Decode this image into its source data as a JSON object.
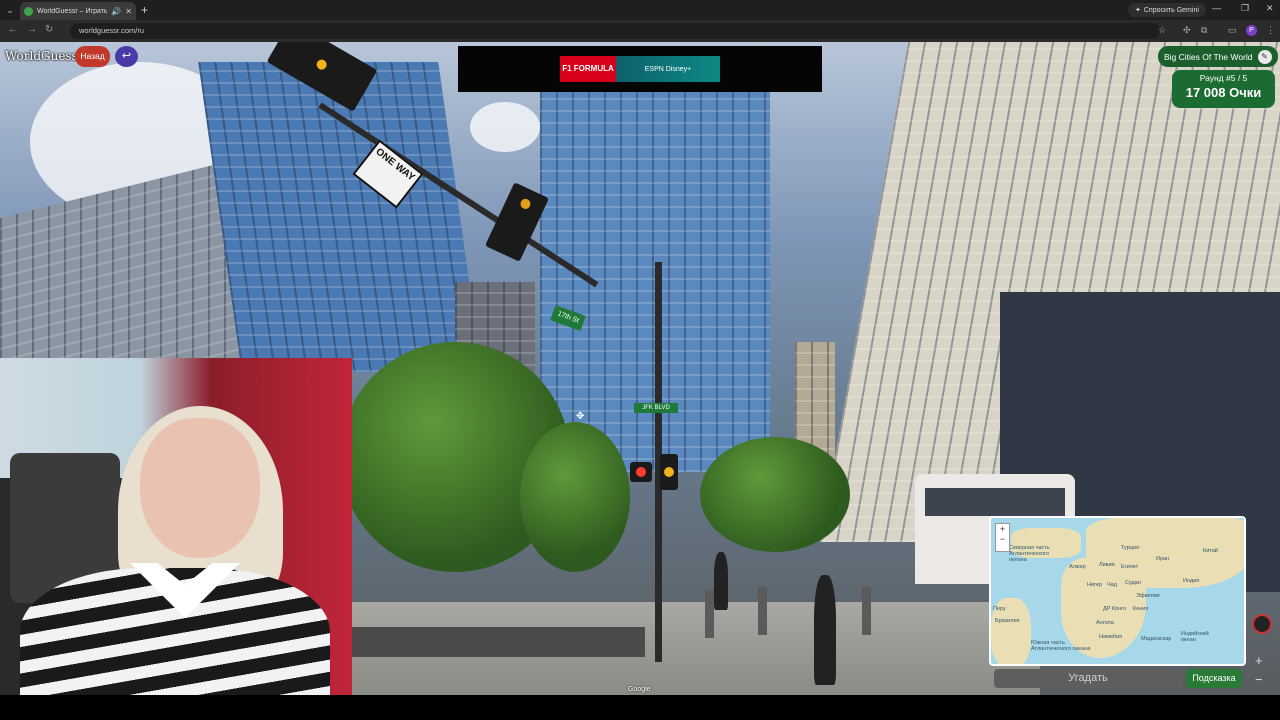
{
  "browser": {
    "tab_title": "WorldGuessr – Играть в Ge",
    "url": "worldguessr.com/ru",
    "gemini_label": "Спросить Gemini",
    "profile_initial": "P"
  },
  "game": {
    "logo": "WorldGuessr",
    "back_label": "Назад",
    "map_name": "Big Cities Of The World",
    "round": "Раунд #5 / 5",
    "points": "17 008 Очки",
    "guess_label": "Угадать",
    "hint_label": "Подсказка",
    "google_mark": "Google"
  },
  "ad": {
    "left": "F1 FORMULA",
    "right": "ESPN  Disney+"
  },
  "scene": {
    "sign_oneway": "ONE WAY",
    "street_sign": "17th St",
    "street_sign2": "JFK BLVD"
  },
  "minimap": {
    "labels": [
      "Северная часть Атлантического океана",
      "Алжир",
      "Ливия",
      "Египет",
      "Турция",
      "Иран",
      "Индия",
      "Китай",
      "Нигер",
      "Чад",
      "Судан",
      "Эфиопия",
      "Кения",
      "ДР Конго",
      "Ангола",
      "Намибия",
      "Южная часть Атлантического океана",
      "Индийский океан",
      "Бразилия",
      "Перу",
      "Мадагаскар"
    ]
  },
  "colors": {
    "back_button": "#c0392b",
    "score_green": "#1c6b33",
    "hint_green": "#2a7a37",
    "undo_purple": "#4a3aa8"
  }
}
